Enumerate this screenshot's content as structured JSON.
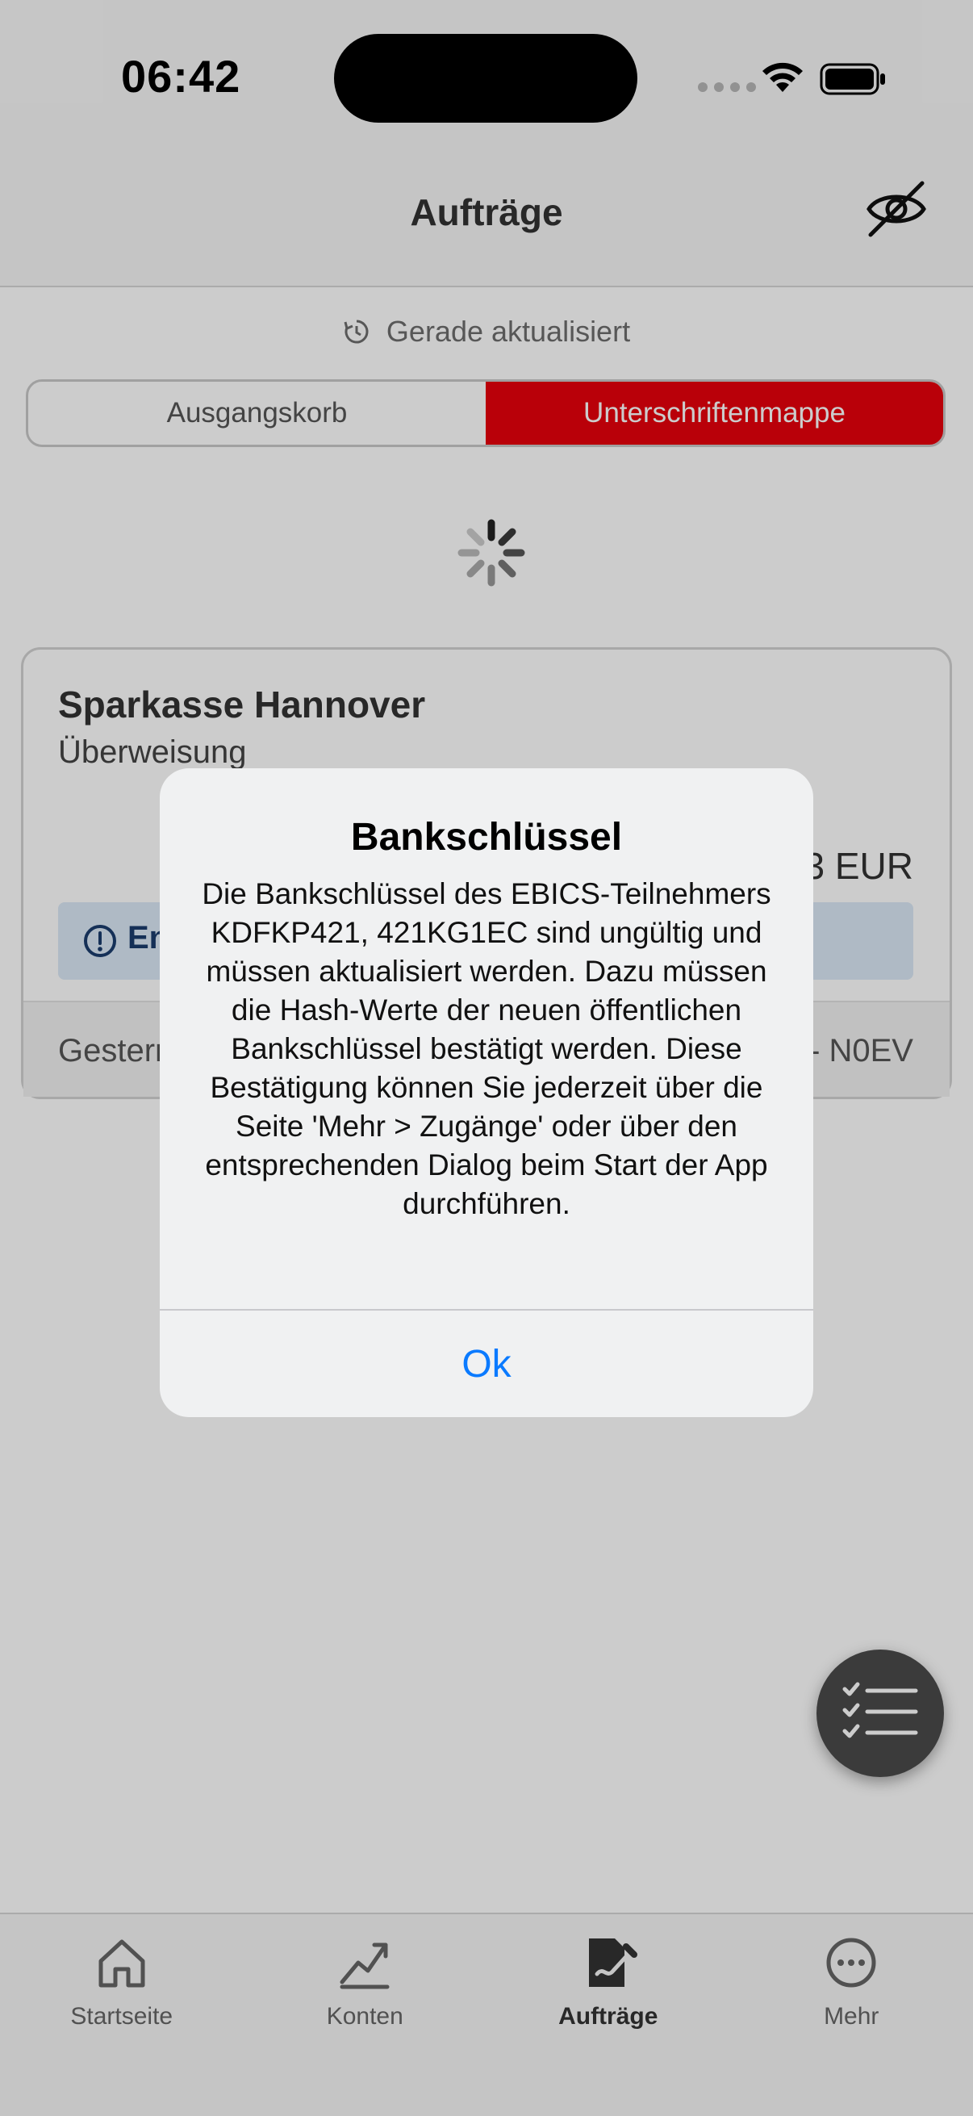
{
  "status_bar": {
    "time": "06:42"
  },
  "header": {
    "title": "Aufträge",
    "hide_icon": "eye-slash-icon"
  },
  "refresh": {
    "icon": "clock-refresh-icon",
    "text": "Gerade aktualisiert"
  },
  "segments": [
    {
      "label": "Ausgangskorb",
      "selected": false
    },
    {
      "label": "Unterschriftenmappe",
      "selected": true
    }
  ],
  "loading": {
    "icon": "spinner-icon"
  },
  "card": {
    "bank": "Sparkasse Hannover",
    "type": "Überweisung",
    "amount_visible": "3 EUR",
    "info_visible": "En",
    "date_visible": "Gestern",
    "reference_visible": "- N0EV"
  },
  "fab": {
    "icon": "checklist-icon"
  },
  "tabs": [
    {
      "label": "Startseite",
      "icon": "home-icon",
      "active": false
    },
    {
      "label": "Konten",
      "icon": "chart-line-icon",
      "active": false
    },
    {
      "label": "Aufträge",
      "icon": "document-sign-icon",
      "active": true
    },
    {
      "label": "Mehr",
      "icon": "more-icon",
      "active": false
    }
  ],
  "alert": {
    "title": "Bankschlüssel",
    "message": "Die Bankschlüssel des EBICS-Teilnehmers KDFKP421, 421KG1EC sind ungültig und müssen aktualisiert werden. Dazu müssen die Hash-Werte der neuen öffentlichen Bankschlüssel bestätigt werden. Diese Bestätigung können Sie jederzeit über die Seite 'Mehr > Zugänge' oder über den entsprechenden Dialog beim Start der App durchführen.",
    "ok_label": "Ok"
  },
  "colors": {
    "accent_red": "#e8010c",
    "link_blue": "#0a7aff",
    "info_bg": "#dbe9f7"
  }
}
